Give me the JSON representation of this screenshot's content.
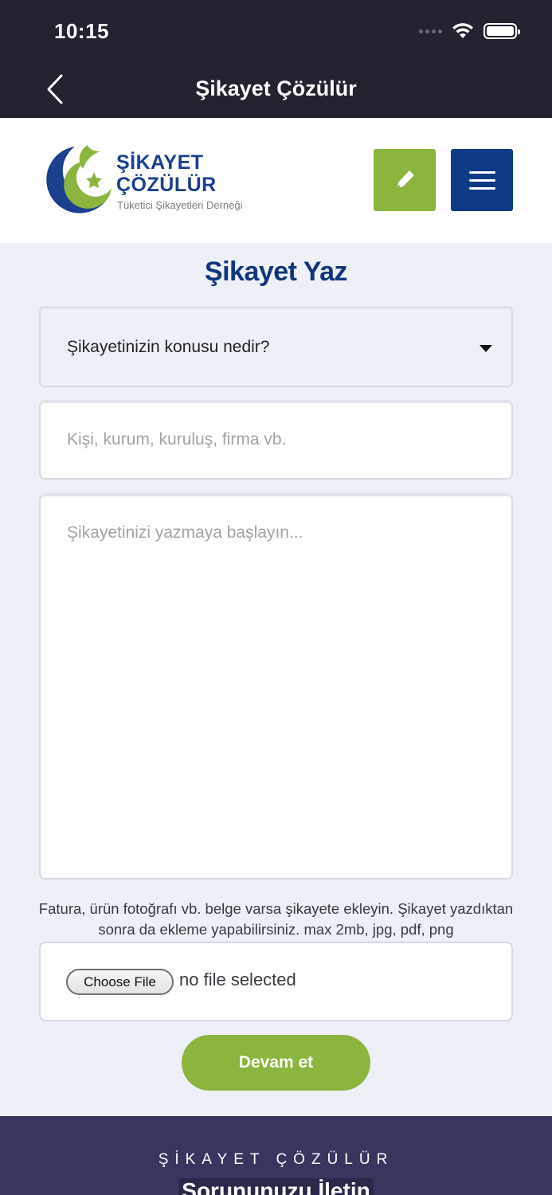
{
  "status_bar": {
    "time": "10:15"
  },
  "nav": {
    "title": "Şikayet Çözülür"
  },
  "header": {
    "logo_line1": "ŞİKAYET",
    "logo_line2": "ÇÖZÜLÜR",
    "logo_subtitle": "Tüketici Şikayetleri Derneği"
  },
  "form": {
    "heading": "Şikayet Yaz",
    "topic_select": "Şikayetinizin konusu nedir?",
    "company_placeholder": "Kişi, kurum, kuruluş, firma vb.",
    "complaint_placeholder": "Şikayetinizi yazmaya başlayın...",
    "file_hint": "Fatura, ürün fotoğrafı vb. belge varsa şikayete ekleyin. Şikayet yazdıktan sonra da ekleme yapabilirsiniz. max 2mb, jpg, pdf, png",
    "choose_file_label": "Choose File",
    "file_status": "no file selected",
    "submit_label": "Devam et"
  },
  "footer": {
    "brand": "ŞİKAYET ÇÖZÜLÜR",
    "cta": "Sorununuzu İletin"
  },
  "colors": {
    "nav_bg": "#23232f",
    "brand_blue": "#10357f",
    "accent_green": "#8cb53f",
    "footer_bg": "#38355f"
  }
}
